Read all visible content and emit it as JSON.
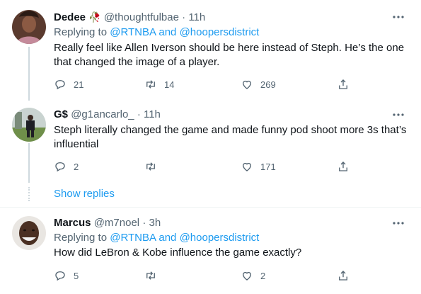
{
  "tweets": [
    {
      "name": "Dedee",
      "emoji": "🥀",
      "handle": "@thoughtfulbae",
      "sep": "·",
      "time": "11h",
      "replying_prefix": "Replying to ",
      "replying_user1": "@RTNBA",
      "replying_and": " and ",
      "replying_user2": "@hoopersdistrict",
      "text": "Really feel like Allen Iverson should be here instead of Steph. He’s the one that changed the image of a player.",
      "replies": "21",
      "retweets": "14",
      "likes": "269"
    },
    {
      "name": "G$",
      "handle": "@g1ancarlo_",
      "sep": "·",
      "time": "11h",
      "text": "Steph literally changed the game and made funny pod shoot more 3s that’s influential",
      "replies": "2",
      "retweets": "",
      "likes": "171"
    },
    {
      "name": "Marcus",
      "handle": "@m7noel",
      "sep": "·",
      "time": "3h",
      "replying_prefix": "Replying to ",
      "replying_user1": "@RTNBA",
      "replying_and": " and ",
      "replying_user2": "@hoopersdistrict",
      "text": "How did LeBron & Kobe influence the game exactly?",
      "replies": "5",
      "retweets": "",
      "likes": "2"
    }
  ],
  "show_replies": "Show replies",
  "colors": {
    "accent": "#1d9bf0",
    "muted": "#536471",
    "text": "#0f1419",
    "line": "#cfd9de"
  }
}
